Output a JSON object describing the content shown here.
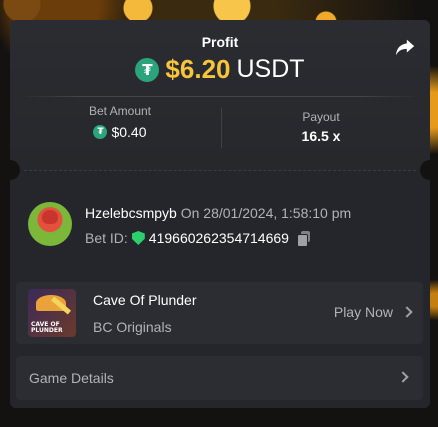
{
  "header": {
    "profit_label": "Profit",
    "profit_value": "$6.20",
    "profit_currency": "USDT",
    "currency_icon": "tether-icon",
    "share_icon": "share-arrow-icon"
  },
  "stats": {
    "bet_amount_label": "Bet Amount",
    "bet_amount_value": "$0.40",
    "payout_label": "Payout",
    "payout_value": "16.5 x"
  },
  "bet": {
    "username": "Hzelebcsmpyb",
    "on_text": "On 28/01/2024, 1:58:10 pm",
    "bet_id_label": "Bet ID:",
    "bet_id": "419660262354714669",
    "verified_icon": "shield-check-icon",
    "copy_icon": "copy-icon"
  },
  "game": {
    "name": "Cave Of Plunder",
    "provider": "BC Originals",
    "play_label": "Play Now",
    "thumb_text": "CAVE OF PLUNDER"
  },
  "details": {
    "label": "Game Details"
  },
  "colors": {
    "accent_gold": "#f7c43a",
    "tether_green": "#2ba37b",
    "verified_green": "#2ccf6b",
    "card_bg": "#24262b"
  }
}
